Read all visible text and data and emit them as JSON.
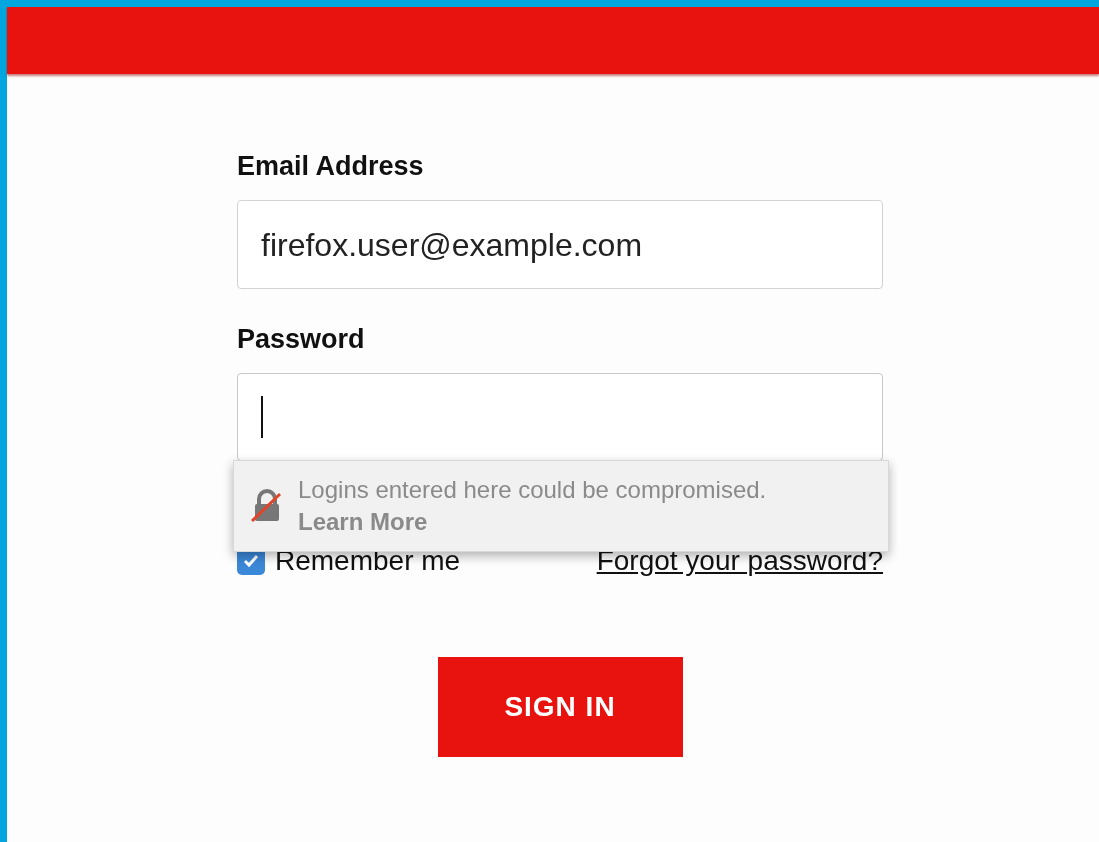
{
  "email": {
    "label": "Email Address",
    "value": "firefox.user@example.com"
  },
  "password": {
    "label": "Password",
    "focused": true
  },
  "warning": {
    "message": "Logins entered here could be compromised.",
    "link": "Learn More"
  },
  "remember": {
    "label": "Remember me",
    "checked": true
  },
  "forgot_link": "Forgot your password?",
  "sign_in_button": "SIGN IN"
}
